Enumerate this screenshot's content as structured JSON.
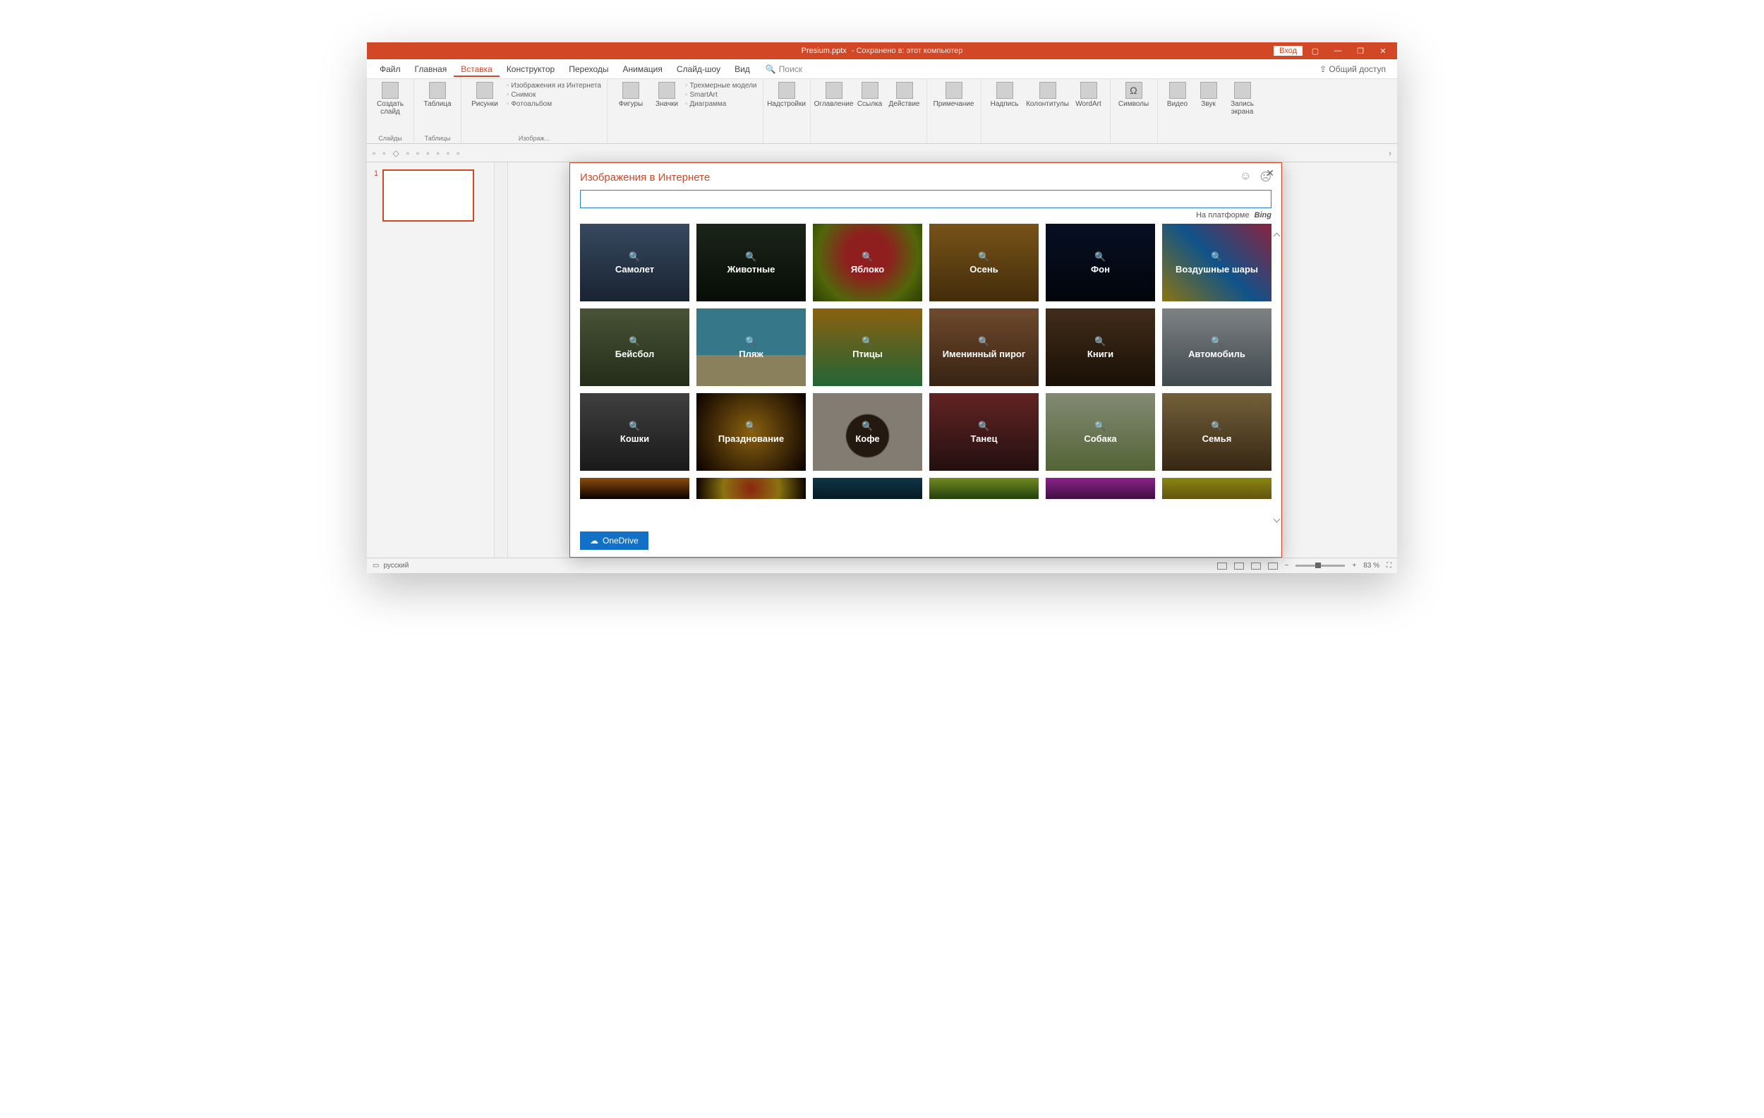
{
  "titlebar": {
    "filename": "Presium.pptx",
    "saved_suffix": "- Сохранено в: этот компьютер",
    "signin": "Вход"
  },
  "ribbon": {
    "tabs": [
      "Файл",
      "Главная",
      "Вставка",
      "Конструктор",
      "Переходы",
      "Анимация",
      "Слайд-шоу",
      "Вид"
    ],
    "active_tab_index": 2,
    "search_label": "Поиск",
    "share_label": "Общий доступ",
    "groups": {
      "slides": {
        "new_slide": "Создать слайд",
        "label": "Слайды"
      },
      "tables": {
        "table": "Таблица",
        "label": "Таблицы"
      },
      "images": {
        "pictures": "Рисунки",
        "online": "Изображения из Интернета",
        "screenshot": "Снимок",
        "album": "Фотоальбом",
        "label": "Изображ..."
      },
      "illustr": {
        "shapes": "Фигуры",
        "icons": "Значки",
        "models3d": "Трехмерные модели",
        "smartart": "SmartArt",
        "chart": "Диаграмма"
      },
      "addins": {
        "addins": "Надстройки"
      },
      "links": {
        "toc": "Оглавление",
        "link": "Ссылка",
        "action": "Действие"
      },
      "comments": {
        "comment": "Примечание"
      },
      "text": {
        "textbox": "Надпись",
        "headerfooter": "Колонтитулы",
        "wordart": "WordArt"
      },
      "symbols": {
        "symbol": "Символы"
      },
      "media": {
        "video": "Видео",
        "audio": "Звук",
        "screenrec": "Запись экрана"
      }
    }
  },
  "thumbs": {
    "slide1_num": "1"
  },
  "dialog": {
    "title": "Изображения в Интернете",
    "powered_by": "На платформе",
    "bing": "Bing",
    "onedrive": "OneDrive",
    "categories_r1": [
      "Самолет",
      "Животные",
      "Яблоко",
      "Осень",
      "Фон",
      "Воздушные шары"
    ],
    "categories_r2": [
      "Бейсбол",
      "Пляж",
      "Птицы",
      "Именинный пирог",
      "Книги",
      "Автомобиль"
    ],
    "categories_r3": [
      "Кошки",
      "Празднование",
      "Кофе",
      "Танец",
      "Собака",
      "Семья"
    ],
    "category_bg_r1": [
      "airplane",
      "animals",
      "apple",
      "autumn",
      "bg",
      "balloons"
    ],
    "category_bg_r2": [
      "baseball",
      "beach",
      "birds",
      "cake",
      "books",
      "car"
    ],
    "category_bg_r3": [
      "cats",
      "celebr",
      "coffee",
      "dance",
      "dog",
      "family"
    ],
    "category_bg_r4": [
      "fire",
      "fireworks",
      "fish",
      "flower1",
      "flower2",
      "flower3"
    ]
  },
  "statusbar": {
    "language": "русский",
    "zoom": "83 %"
  }
}
